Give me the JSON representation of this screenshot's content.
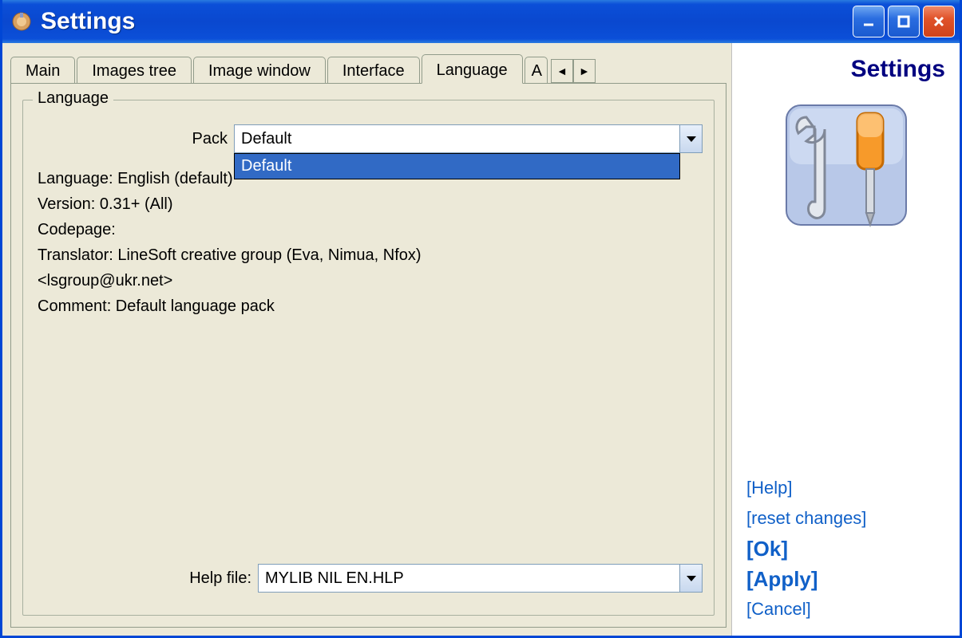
{
  "window": {
    "title": "Settings"
  },
  "tabs": {
    "items": [
      "Main",
      "Images tree",
      "Image window",
      "Interface",
      "Language",
      "A"
    ],
    "active_index": 4
  },
  "language_panel": {
    "fieldset_label": "Language",
    "pack_label": "Pack",
    "pack_value": "Default",
    "pack_dropdown_option": "Default",
    "info": {
      "line1": "Language: English (default)",
      "line2": "Version: 0.31+ (All)",
      "line3": "Codepage:",
      "line4": "Translator: LineSoft creative group (Eva, Nimua, Nfox)",
      "line5": "<lsgroup@ukr.net>",
      "line6": "Comment: Default language pack"
    },
    "help_file_label": "Help file:",
    "help_file_value": "MYLIB NIL EN.HLP"
  },
  "side": {
    "title": "Settings",
    "links": {
      "help": "[Help]",
      "reset": "[reset changes]",
      "ok": "[Ok]",
      "apply": "[Apply]",
      "cancel": "[Cancel]"
    }
  }
}
